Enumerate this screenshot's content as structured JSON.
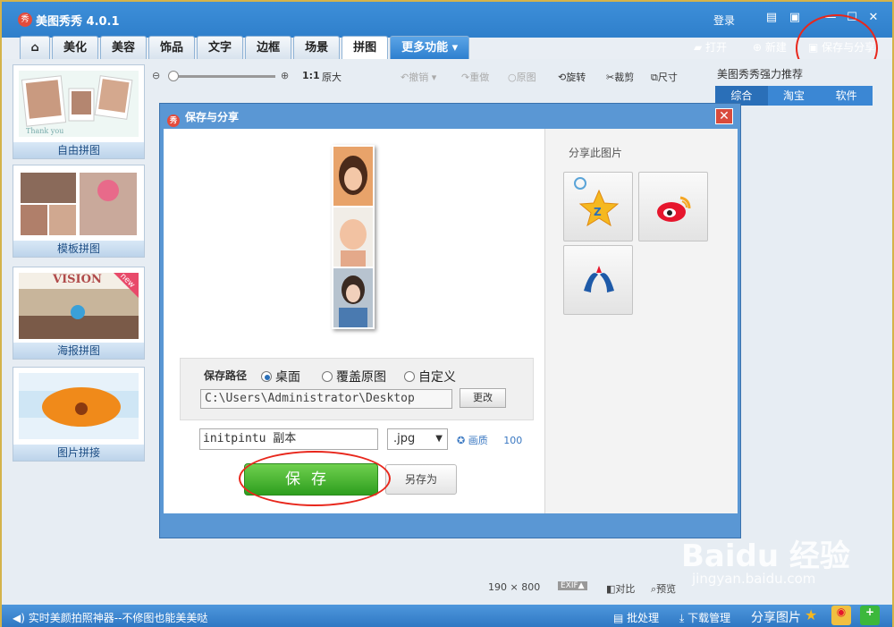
{
  "app": {
    "title": "美图秀秀 4.0.1",
    "login": "登录"
  },
  "tabs": [
    "美化",
    "美容",
    "饰品",
    "文字",
    "边框",
    "场景",
    "拼图",
    "更多功能 ▾"
  ],
  "top_actions": {
    "open": "打开",
    "new": "新建",
    "save_share": "保存与分享"
  },
  "left_panel": {
    "items": [
      "自由拼图",
      "模板拼图",
      "海报拼图",
      "图片拼接"
    ],
    "poster_badge": "new",
    "poster_text": "VISION"
  },
  "toolbar": {
    "zoom_ratio": "1:1",
    "original_size": "原大",
    "undo": "撤销",
    "redo": "重做",
    "original": "原图",
    "rotate": "旋转",
    "crop": "裁剪",
    "size": "尺寸"
  },
  "recommend": {
    "title": "美图秀秀强力推荐",
    "tabs": [
      "综合",
      "淘宝",
      "软件"
    ]
  },
  "dialog": {
    "title": "保存与分享",
    "share_title": "分享此图片",
    "path_label": "保存路径",
    "radio_desktop": "桌面",
    "radio_overwrite": "覆盖原图",
    "radio_custom": "自定义",
    "path_value": "C:\\Users\\Administrator\\Desktop",
    "change": "更改",
    "filename": "initpintu 副本",
    "extension": ".jpg",
    "quality_label": "画质",
    "quality_value": "100",
    "save": "保存",
    "save_as": "另存为"
  },
  "bottom": {
    "dimensions": "190 × 800",
    "exif": "EXIF▲",
    "compare": "对比",
    "preview": "预览"
  },
  "statusbar": {
    "tip": "实时美颜拍照神器--不修图也能美美哒",
    "batch": "批处理",
    "download": "下载管理",
    "share": "分享图片"
  },
  "watermark": {
    "brand": "Baidu 经验",
    "url": "jingyan.baidu.com"
  },
  "colors": {
    "title_bar": "#2f7fcb",
    "save_button": "#2e9e1f",
    "highlight_ring": "#e8271c"
  }
}
